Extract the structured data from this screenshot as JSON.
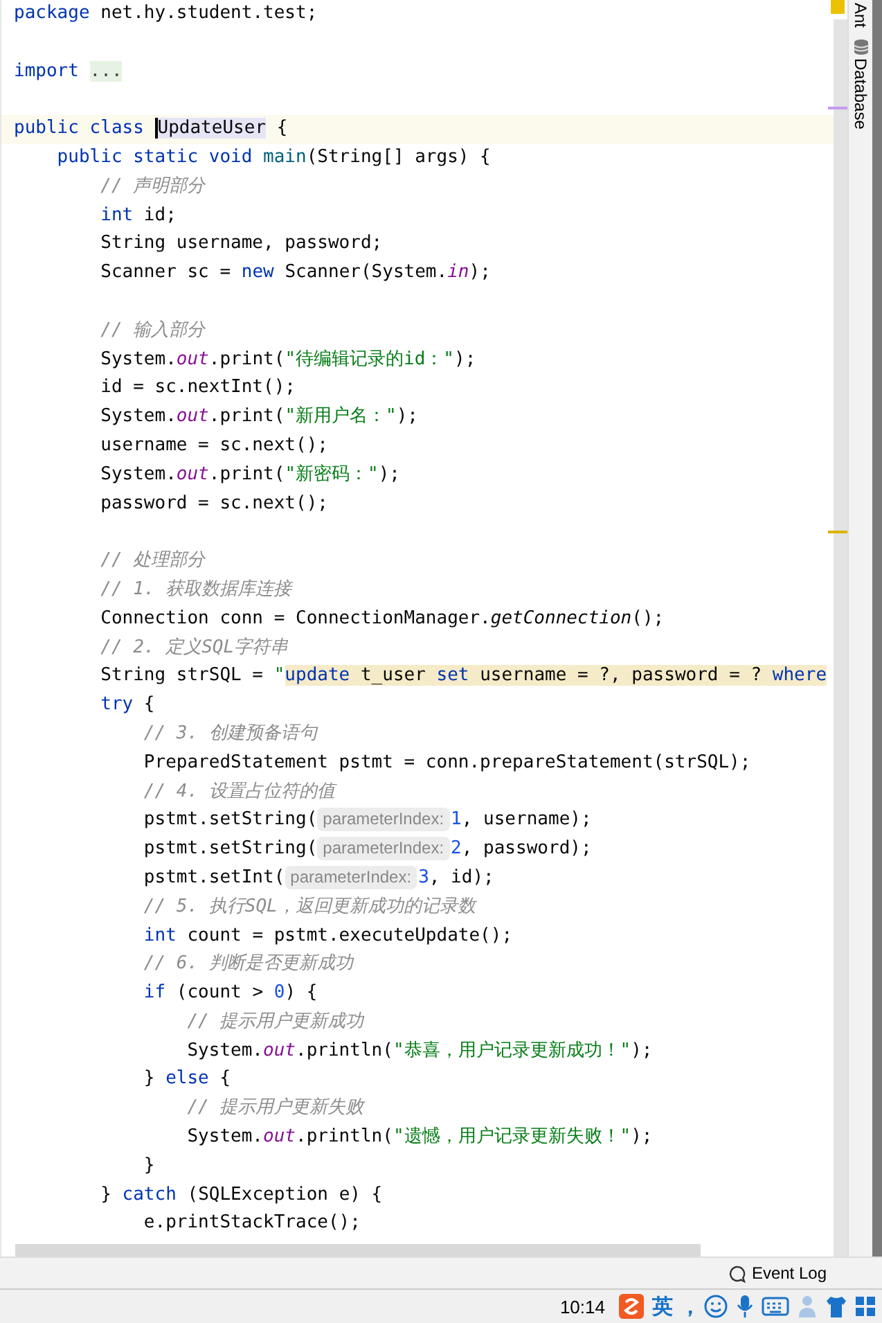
{
  "editor": {
    "lines": [
      {
        "current": false,
        "tokens": [
          {
            "kind": "kw",
            "text": "package "
          },
          {
            "kind": "p",
            "text": "net.hy.student.test;"
          }
        ]
      },
      {
        "current": false
      },
      {
        "current": false,
        "tokens": [
          {
            "kind": "kw",
            "text": "import "
          },
          {
            "kind": "fold",
            "text": "..."
          }
        ]
      },
      {
        "current": false
      },
      {
        "current": true,
        "tokens": [
          {
            "kind": "kw",
            "text": "public class "
          },
          {
            "kind": "hl",
            "text": "UpdateUser"
          },
          {
            "kind": "p",
            "text": " {"
          }
        ]
      },
      {
        "current": false,
        "tokens": [
          {
            "kind": "kw",
            "text": "    public static void "
          },
          {
            "kind": "decl",
            "text": "main"
          },
          {
            "kind": "p",
            "text": "(String[] args) {"
          }
        ]
      },
      {
        "current": false,
        "tokens": [
          {
            "kind": "c",
            "text": "        // 声明部分"
          }
        ]
      },
      {
        "current": false,
        "tokens": [
          {
            "kind": "kw",
            "text": "        int "
          },
          {
            "kind": "p",
            "text": "id;"
          }
        ]
      },
      {
        "current": false,
        "tokens": [
          {
            "kind": "p",
            "text": "        String username, password;"
          }
        ]
      },
      {
        "current": false,
        "tokens": [
          {
            "kind": "p",
            "text": "        Scanner sc = "
          },
          {
            "kind": "kw",
            "text": "new "
          },
          {
            "kind": "p",
            "text": "Scanner(System."
          },
          {
            "kind": "f",
            "text": "in"
          },
          {
            "kind": "p",
            "text": ");"
          }
        ]
      },
      {
        "current": false
      },
      {
        "current": false,
        "tokens": [
          {
            "kind": "c",
            "text": "        // 输入部分"
          }
        ]
      },
      {
        "current": false,
        "tokens": [
          {
            "kind": "p",
            "text": "        System."
          },
          {
            "kind": "f",
            "text": "out"
          },
          {
            "kind": "p",
            "text": ".print("
          },
          {
            "kind": "s",
            "text": "\"待编辑记录的id：\""
          },
          {
            "kind": "p",
            "text": ");"
          }
        ]
      },
      {
        "current": false,
        "tokens": [
          {
            "kind": "p",
            "text": "        id = sc.nextInt();"
          }
        ]
      },
      {
        "current": false,
        "tokens": [
          {
            "kind": "p",
            "text": "        System."
          },
          {
            "kind": "f",
            "text": "out"
          },
          {
            "kind": "p",
            "text": ".print("
          },
          {
            "kind": "s",
            "text": "\"新用户名：\""
          },
          {
            "kind": "p",
            "text": ");"
          }
        ]
      },
      {
        "current": false,
        "tokens": [
          {
            "kind": "p",
            "text": "        username = sc.next();"
          }
        ]
      },
      {
        "current": false,
        "tokens": [
          {
            "kind": "p",
            "text": "        System."
          },
          {
            "kind": "f",
            "text": "out"
          },
          {
            "kind": "p",
            "text": ".print("
          },
          {
            "kind": "s",
            "text": "\"新密码：\""
          },
          {
            "kind": "p",
            "text": ");"
          }
        ]
      },
      {
        "current": false,
        "tokens": [
          {
            "kind": "p",
            "text": "        password = sc.next();"
          }
        ]
      },
      {
        "current": false
      },
      {
        "current": false,
        "tokens": [
          {
            "kind": "c",
            "text": "        // 处理部分"
          }
        ]
      },
      {
        "current": false,
        "tokens": [
          {
            "kind": "c",
            "text": "        // 1. 获取数据库连接"
          }
        ]
      },
      {
        "current": false,
        "tokens": [
          {
            "kind": "p",
            "text": "        Connection conn = ConnectionManager."
          },
          {
            "kind": "m",
            "text": "getConnection"
          },
          {
            "kind": "p",
            "text": "();"
          }
        ]
      },
      {
        "current": false,
        "tokens": [
          {
            "kind": "c",
            "text": "        // 2. 定义SQL字符串"
          }
        ]
      },
      {
        "current": false,
        "tokens": [
          {
            "kind": "p",
            "text": "        String strSQL = "
          },
          {
            "kind": "s",
            "text": "\""
          },
          {
            "kind": "sk",
            "text": "update"
          },
          {
            "kind": "sq",
            "text": " t_user "
          },
          {
            "kind": "sk",
            "text": "set"
          },
          {
            "kind": "sq",
            "text": " username = ?, password = ? "
          },
          {
            "kind": "sk",
            "text": "where"
          }
        ]
      },
      {
        "current": false,
        "tokens": [
          {
            "kind": "kw",
            "text": "        try "
          },
          {
            "kind": "p",
            "text": "{"
          }
        ]
      },
      {
        "current": false,
        "tokens": [
          {
            "kind": "c",
            "text": "            // 3. 创建预备语句"
          }
        ]
      },
      {
        "current": false,
        "tokens": [
          {
            "kind": "p",
            "text": "            PreparedStatement pstmt = conn.prepareStatement(strSQL);"
          }
        ]
      },
      {
        "current": false,
        "tokens": [
          {
            "kind": "c",
            "text": "            // 4. 设置占位符的值"
          }
        ]
      },
      {
        "current": false,
        "tokens": [
          {
            "kind": "p",
            "text": "            pstmt.setString("
          },
          {
            "kind": "h",
            "text": "parameterIndex:"
          },
          {
            "kind": "n",
            "text": "1"
          },
          {
            "kind": "p",
            "text": ", username);"
          }
        ]
      },
      {
        "current": false,
        "tokens": [
          {
            "kind": "p",
            "text": "            pstmt.setString("
          },
          {
            "kind": "h",
            "text": "parameterIndex:"
          },
          {
            "kind": "n",
            "text": "2"
          },
          {
            "kind": "p",
            "text": ", password);"
          }
        ]
      },
      {
        "current": false,
        "tokens": [
          {
            "kind": "p",
            "text": "            pstmt.setInt("
          },
          {
            "kind": "h",
            "text": "parameterIndex:"
          },
          {
            "kind": "n",
            "text": "3"
          },
          {
            "kind": "p",
            "text": ", id);"
          }
        ]
      },
      {
        "current": false,
        "tokens": [
          {
            "kind": "c",
            "text": "            // 5. 执行SQL，返回更新成功的记录数"
          }
        ]
      },
      {
        "current": false,
        "tokens": [
          {
            "kind": "kw",
            "text": "            int "
          },
          {
            "kind": "p",
            "text": "count = pstmt.executeUpdate();"
          }
        ]
      },
      {
        "current": false,
        "tokens": [
          {
            "kind": "c",
            "text": "            // 6. 判断是否更新成功"
          }
        ]
      },
      {
        "current": false,
        "tokens": [
          {
            "kind": "kw",
            "text": "            if "
          },
          {
            "kind": "p",
            "text": "(count > "
          },
          {
            "kind": "n",
            "text": "0"
          },
          {
            "kind": "p",
            "text": ") {"
          }
        ]
      },
      {
        "current": false,
        "tokens": [
          {
            "kind": "c",
            "text": "                // 提示用户更新成功"
          }
        ]
      },
      {
        "current": false,
        "tokens": [
          {
            "kind": "p",
            "text": "                System."
          },
          {
            "kind": "f",
            "text": "out"
          },
          {
            "kind": "p",
            "text": ".println("
          },
          {
            "kind": "s",
            "text": "\"恭喜，用户记录更新成功！\""
          },
          {
            "kind": "p",
            "text": ");"
          }
        ]
      },
      {
        "current": false,
        "tokens": [
          {
            "kind": "p",
            "text": "            } "
          },
          {
            "kind": "kw",
            "text": "else "
          },
          {
            "kind": "p",
            "text": "{"
          }
        ]
      },
      {
        "current": false,
        "tokens": [
          {
            "kind": "c",
            "text": "                // 提示用户更新失败"
          }
        ]
      },
      {
        "current": false,
        "tokens": [
          {
            "kind": "p",
            "text": "                System."
          },
          {
            "kind": "f",
            "text": "out"
          },
          {
            "kind": "p",
            "text": ".println("
          },
          {
            "kind": "s",
            "text": "\"遗憾，用户记录更新失败！\""
          },
          {
            "kind": "p",
            "text": ");"
          }
        ]
      },
      {
        "current": false,
        "tokens": [
          {
            "kind": "p",
            "text": "            }"
          }
        ]
      },
      {
        "current": false,
        "tokens": [
          {
            "kind": "p",
            "text": "        } "
          },
          {
            "kind": "kw",
            "text": "catch "
          },
          {
            "kind": "p",
            "text": "(SQLException e) {"
          }
        ]
      },
      {
        "current": false,
        "tokens": [
          {
            "kind": "p",
            "text": "            e.printStackTrace();"
          }
        ]
      }
    ]
  },
  "tool_strip": {
    "tabs": [
      {
        "label": "Ant"
      },
      {
        "label": "Database"
      }
    ]
  },
  "status_bar": {
    "event_log": "Event Log"
  },
  "taskbar": {
    "time": "10:14",
    "ime_mode": "英",
    "punctuation": "，"
  }
}
